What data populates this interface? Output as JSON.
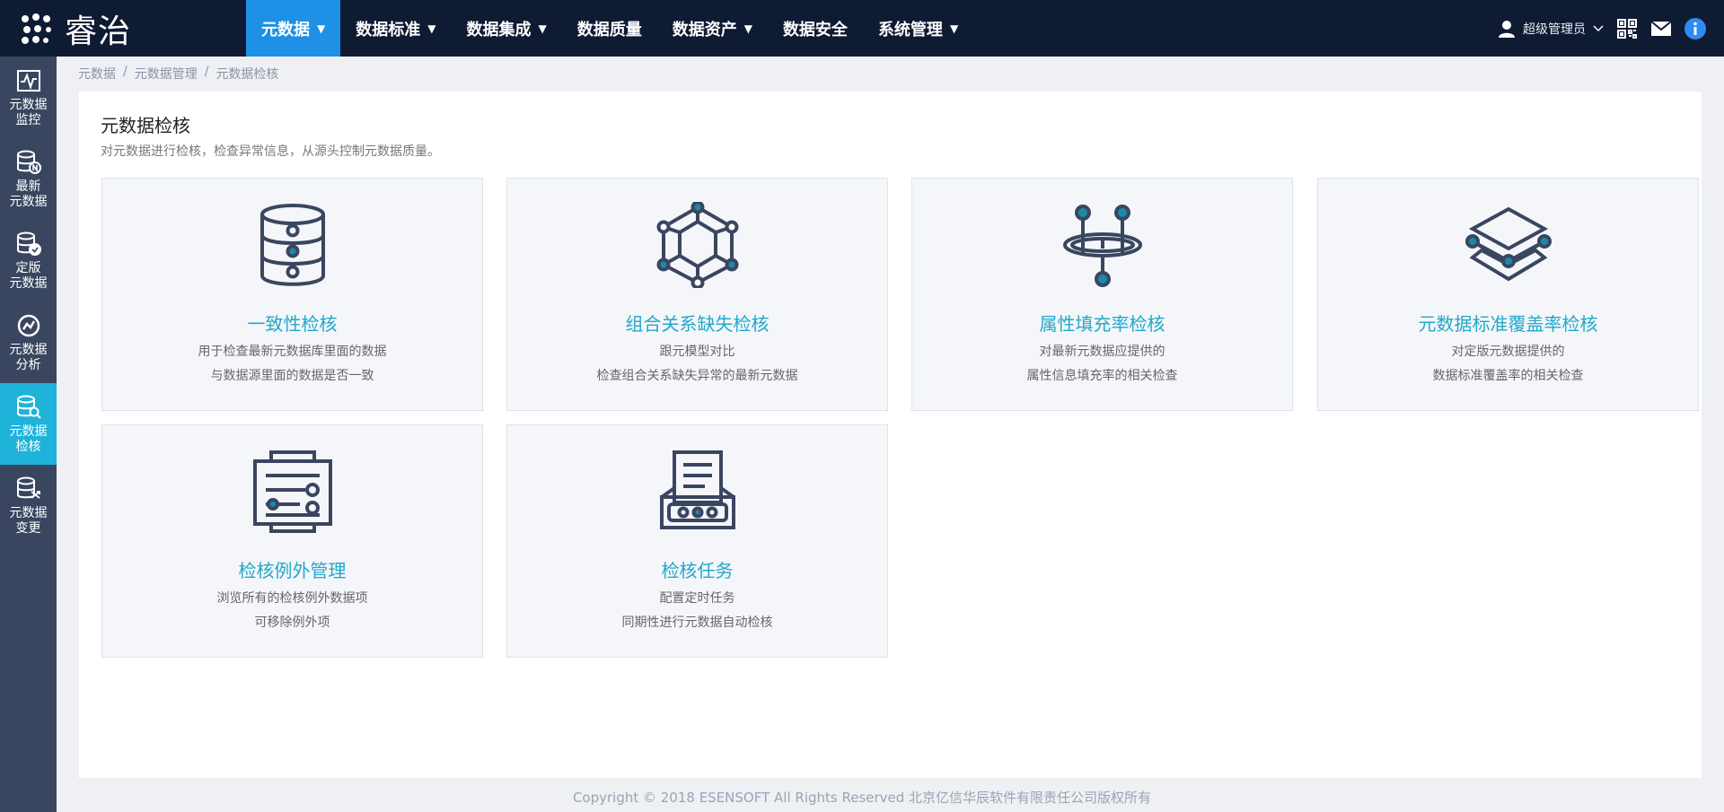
{
  "app": {
    "logo_text": "睿治"
  },
  "nav": {
    "items": [
      {
        "label": "元数据",
        "has_caret": true
      },
      {
        "label": "数据标准",
        "has_caret": true
      },
      {
        "label": "数据集成",
        "has_caret": true
      },
      {
        "label": "数据质量",
        "has_caret": false
      },
      {
        "label": "数据资产",
        "has_caret": true
      },
      {
        "label": "数据安全",
        "has_caret": false
      },
      {
        "label": "系统管理",
        "has_caret": true
      }
    ],
    "caret": "▼",
    "user_name": "超级管理员"
  },
  "sidebar": {
    "items": [
      {
        "line1": "元数据",
        "line2": "监控",
        "icon": "monitor-chart-icon"
      },
      {
        "line1": "最新",
        "line2": "元数据",
        "icon": "database-new-icon"
      },
      {
        "line1": "定版",
        "line2": "元数据",
        "icon": "database-check-icon"
      },
      {
        "line1": "元数据",
        "line2": "分析",
        "icon": "analysis-icon"
      },
      {
        "line1": "元数据",
        "line2": "检核",
        "icon": "database-search-icon"
      },
      {
        "line1": "元数据",
        "line2": "变更",
        "icon": "database-change-icon"
      }
    ]
  },
  "breadcrumb": {
    "items": [
      "元数据",
      "元数据管理",
      "元数据检核"
    ],
    "separator": "/"
  },
  "page": {
    "title": "元数据检核",
    "description": "对元数据进行检核，检查异常信息，从源头控制元数据质量。"
  },
  "cards": [
    {
      "title": "一致性检核",
      "desc1": "用于检查最新元数据库里面的数据",
      "desc2": "与数据源里面的数据是否一致",
      "icon": "database-icon"
    },
    {
      "title": "组合关系缺失检核",
      "desc1": "跟元模型对比",
      "desc2": "检查组合关系缺失异常的最新元数据",
      "icon": "hexagon-network-icon"
    },
    {
      "title": "属性填充率检核",
      "desc1": "对最新元数据应提供的",
      "desc2": "属性信息填充率的相关检查",
      "icon": "ring-nodes-icon"
    },
    {
      "title": "元数据标准覆盖率检核",
      "desc1": "对定版元数据提供的",
      "desc2": "数据标准覆盖率的相关检查",
      "icon": "layers-icon"
    },
    {
      "title": "检核例外管理",
      "desc1": "浏览所有的检核例外数据项",
      "desc2": "可移除例外项",
      "icon": "exception-list-icon"
    },
    {
      "title": "检核任务",
      "desc1": "配置定时任务",
      "desc2": "同期性进行元数据自动检核",
      "icon": "task-printer-icon"
    }
  ],
  "footer": {
    "text": "Copyright © 2018 ESENSOFT All Rights Reserved 北京亿信华辰软件有限责任公司版权所有"
  },
  "colors": {
    "topbar": "#0f1a33",
    "nav_active": "#1e90e6",
    "sidebar": "#3a4660",
    "sidebar_active": "#1fb3d9",
    "card_title": "#22a8c9",
    "icon_stroke": "#3a4660",
    "icon_dot": "#1b8aa6"
  }
}
